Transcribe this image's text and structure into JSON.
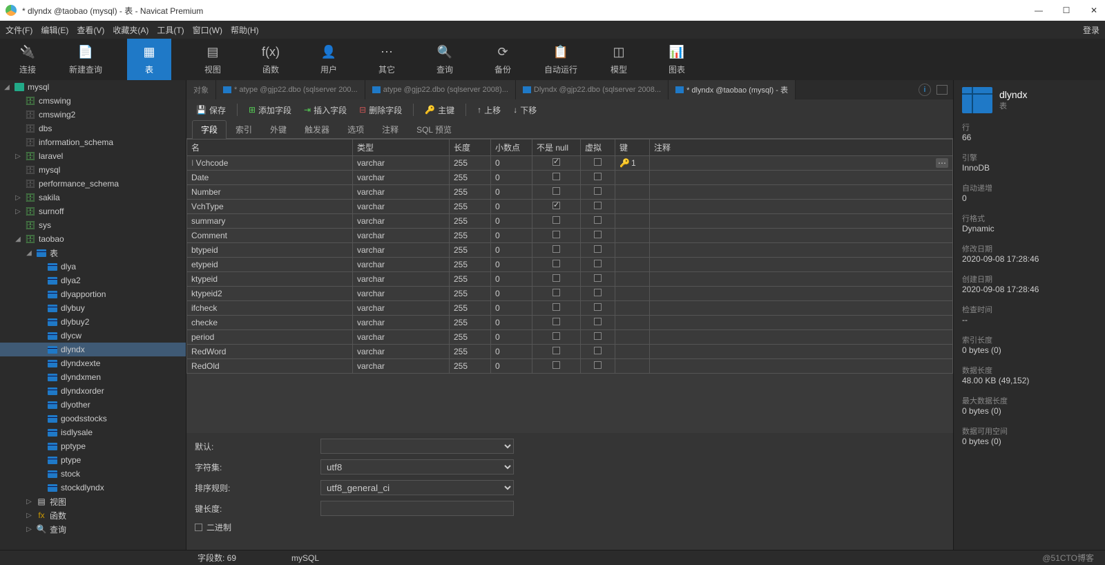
{
  "window": {
    "title": "* dlyndx @taobao (mysql) - 表 - Navicat Premium",
    "login": "登录"
  },
  "menubar": [
    "文件(F)",
    "编辑(E)",
    "查看(V)",
    "收藏夹(A)",
    "工具(T)",
    "窗口(W)",
    "帮助(H)"
  ],
  "toolbar": [
    {
      "label": "连接",
      "icon": "🔌"
    },
    {
      "label": "新建查询",
      "icon": "📄"
    },
    {
      "label": "表",
      "icon": "▦",
      "active": true
    },
    {
      "label": "视图",
      "icon": "▤"
    },
    {
      "label": "函数",
      "icon": "f(x)"
    },
    {
      "label": "用户",
      "icon": "👤"
    },
    {
      "label": "其它",
      "icon": "⋯"
    },
    {
      "label": "查询",
      "icon": "🔍"
    },
    {
      "label": "备份",
      "icon": "⟳"
    },
    {
      "label": "自动运行",
      "icon": "📋"
    },
    {
      "label": "模型",
      "icon": "◫"
    },
    {
      "label": "图表",
      "icon": "📊"
    }
  ],
  "tree": {
    "root": "mysql",
    "databases": [
      {
        "name": "cmswing",
        "open": false,
        "on": true
      },
      {
        "name": "cmswing2",
        "open": false,
        "on": false
      },
      {
        "name": "dbs",
        "open": false,
        "on": false
      },
      {
        "name": "information_schema",
        "open": false,
        "on": false
      },
      {
        "name": "laravel",
        "open": false,
        "on": true
      },
      {
        "name": "mysql",
        "open": false,
        "on": false
      },
      {
        "name": "performance_schema",
        "open": false,
        "on": false
      },
      {
        "name": "sakila",
        "open": false,
        "on": true
      },
      {
        "name": "surnoff",
        "open": false,
        "on": true
      },
      {
        "name": "sys",
        "open": false,
        "on": true
      },
      {
        "name": "taobao",
        "open": true,
        "on": true
      }
    ],
    "taobao_tables_label": "表",
    "taobao_tables": [
      "dlya",
      "dlya2",
      "dlyapportion",
      "dlybuy",
      "dlybuy2",
      "dlycw",
      "dlyndx",
      "dlyndxexte",
      "dlyndxmen",
      "dlyndxorder",
      "dlyother",
      "goodsstocks",
      "isdlysale",
      "pptype",
      "ptype",
      "stock",
      "stockdlyndx"
    ],
    "other_nodes": [
      "视图",
      "函数",
      "查询"
    ],
    "selected_table": "dlyndx"
  },
  "tabs": {
    "object": "对象",
    "list": [
      {
        "label": "* atype @gjp22.dbo (sqlserver 200...",
        "active": false
      },
      {
        "label": "atype @gjp22.dbo (sqlserver 2008)...",
        "active": false
      },
      {
        "label": "Dlyndx @gjp22.dbo (sqlserver 2008...",
        "active": false
      },
      {
        "label": "* dlyndx @taobao (mysql) - 表",
        "active": true
      }
    ]
  },
  "editor_toolbar": {
    "save": "保存",
    "add_field": "添加字段",
    "insert_field": "插入字段",
    "delete_field": "删除字段",
    "primary_key": "主键",
    "move_up": "上移",
    "move_down": "下移"
  },
  "subtabs": [
    "字段",
    "索引",
    "外键",
    "触发器",
    "选项",
    "注释",
    "SQL 预览"
  ],
  "columns": [
    "名",
    "类型",
    "长度",
    "小数点",
    "不是 null",
    "虚拟",
    "键",
    "注释"
  ],
  "fields": [
    {
      "name": "Vchcode",
      "type": "varchar",
      "len": "255",
      "dec": "0",
      "nn": true,
      "virt": false,
      "key": "1"
    },
    {
      "name": "Date",
      "type": "varchar",
      "len": "255",
      "dec": "0",
      "nn": false,
      "virt": false,
      "key": ""
    },
    {
      "name": "Number",
      "type": "varchar",
      "len": "255",
      "dec": "0",
      "nn": false,
      "virt": false,
      "key": ""
    },
    {
      "name": "VchType",
      "type": "varchar",
      "len": "255",
      "dec": "0",
      "nn": true,
      "virt": false,
      "key": ""
    },
    {
      "name": "summary",
      "type": "varchar",
      "len": "255",
      "dec": "0",
      "nn": false,
      "virt": false,
      "key": ""
    },
    {
      "name": "Comment",
      "type": "varchar",
      "len": "255",
      "dec": "0",
      "nn": false,
      "virt": false,
      "key": ""
    },
    {
      "name": "btypeid",
      "type": "varchar",
      "len": "255",
      "dec": "0",
      "nn": false,
      "virt": false,
      "key": ""
    },
    {
      "name": "etypeid",
      "type": "varchar",
      "len": "255",
      "dec": "0",
      "nn": false,
      "virt": false,
      "key": ""
    },
    {
      "name": "ktypeid",
      "type": "varchar",
      "len": "255",
      "dec": "0",
      "nn": false,
      "virt": false,
      "key": ""
    },
    {
      "name": "ktypeid2",
      "type": "varchar",
      "len": "255",
      "dec": "0",
      "nn": false,
      "virt": false,
      "key": ""
    },
    {
      "name": "ifcheck",
      "type": "varchar",
      "len": "255",
      "dec": "0",
      "nn": false,
      "virt": false,
      "key": ""
    },
    {
      "name": "checke",
      "type": "varchar",
      "len": "255",
      "dec": "0",
      "nn": false,
      "virt": false,
      "key": ""
    },
    {
      "name": "period",
      "type": "varchar",
      "len": "255",
      "dec": "0",
      "nn": false,
      "virt": false,
      "key": ""
    },
    {
      "name": "RedWord",
      "type": "varchar",
      "len": "255",
      "dec": "0",
      "nn": false,
      "virt": false,
      "key": ""
    },
    {
      "name": "RedOld",
      "type": "varchar",
      "len": "255",
      "dec": "0",
      "nn": false,
      "virt": false,
      "key": ""
    }
  ],
  "form": {
    "default_label": "默认:",
    "default_value": "",
    "charset_label": "字符集:",
    "charset_value": "utf8",
    "collation_label": "排序规则:",
    "collation_value": "utf8_general_ci",
    "keylen_label": "键长度:",
    "keylen_value": "",
    "binary_label": "二进制"
  },
  "props": {
    "title": "dlyndx",
    "subtitle": "表",
    "rows_label": "行",
    "rows_value": "66",
    "engine_label": "引擎",
    "engine_value": "InnoDB",
    "autoinc_label": "自动递增",
    "autoinc_value": "0",
    "rowfmt_label": "行格式",
    "rowfmt_value": "Dynamic",
    "modify_label": "修改日期",
    "modify_value": "2020-09-08 17:28:46",
    "create_label": "创建日期",
    "create_value": "2020-09-08 17:28:46",
    "check_label": "检查时间",
    "check_value": "--",
    "idxlen_label": "索引长度",
    "idxlen_value": "0 bytes (0)",
    "datalen_label": "数据长度",
    "datalen_value": "48.00 KB (49,152)",
    "maxdata_label": "最大数据长度",
    "maxdata_value": "0 bytes (0)",
    "avail_label": "数据可用空间",
    "avail_value": "0 bytes (0)"
  },
  "status": {
    "field_count": "字段数: 69",
    "right": "@51CTO博客",
    "extra": "mySQL"
  }
}
